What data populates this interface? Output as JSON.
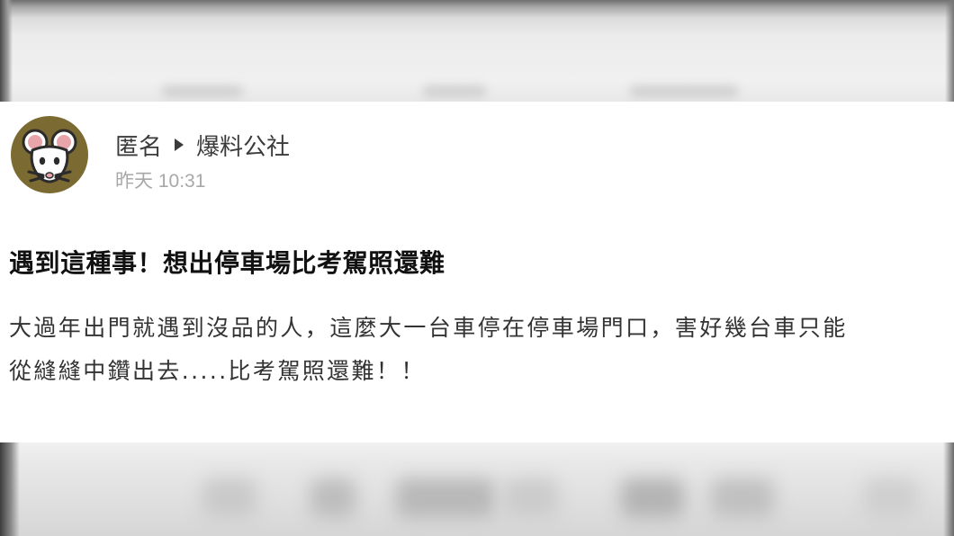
{
  "post": {
    "author": "匿名",
    "board": "爆料公社",
    "timestamp": "昨天 10:31",
    "title": "遇到這種事！想出停車場比考駕照還難",
    "body_lines": [
      "大過年出門就遇到沒品的人，這麼大一台車停在停車場門口，害好幾台車只能",
      "從縫縫中鑽出去.....比考駕照還難！！"
    ]
  },
  "icons": {
    "avatar": "mouse-avatar-icon",
    "separator": "play-triangle-icon"
  },
  "colors": {
    "avatar_background": "#7b6a31",
    "author_text": "#3b3b3b",
    "timestamp_text": "#a8a8a8",
    "title_text": "#111111",
    "body_text": "#333333"
  }
}
